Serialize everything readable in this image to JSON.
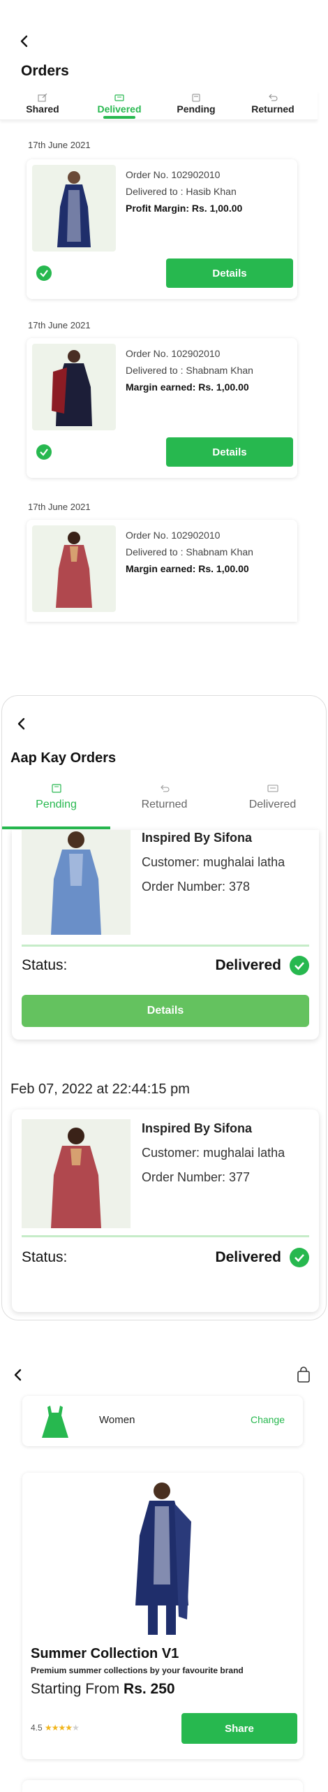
{
  "screen1": {
    "title": "Orders",
    "tabs": [
      {
        "label": "Shared",
        "icon": "share-icon"
      },
      {
        "label": "Delivered",
        "icon": "truck-icon"
      },
      {
        "label": "Pending",
        "icon": "pending-icon"
      },
      {
        "label": "Returned",
        "icon": "return-icon"
      }
    ],
    "active_tab": "Delivered",
    "orders": [
      {
        "date": "17th June 2021",
        "order_no": "Order No. 102902010",
        "delivered_to": "Delivered to : Hasib Khan",
        "margin_label": "Profit Margin:",
        "margin_value": "Rs. 1,00.00",
        "button": "Details"
      },
      {
        "date": "17th June 2021",
        "order_no": "Order No. 102902010",
        "delivered_to": "Delivered to : Shabnam Khan",
        "margin_label": "Margin earned:",
        "margin_value": "Rs. 1,00.00",
        "button": "Details"
      },
      {
        "date": "17th June 2021",
        "order_no": "Order No. 102902010",
        "delivered_to": "Delivered to : Shabnam Khan",
        "margin_label": "Margin earned:",
        "margin_value": "Rs. 1,00.00"
      }
    ]
  },
  "screen2": {
    "title": "Aap Kay Orders",
    "tabs": [
      {
        "label": "Pending",
        "icon": "pending-icon"
      },
      {
        "label": "Returned",
        "icon": "return-icon"
      },
      {
        "label": "Delivered",
        "icon": "truck-icon"
      }
    ],
    "active_tab": "Pending",
    "orders": [
      {
        "brand": "Inspired By Sifona",
        "customer": "Customer: mughalai latha",
        "order_number": "Order Number: 378",
        "status_label": "Status:",
        "status_value": "Delivered",
        "button": "Details"
      },
      {
        "date": "Feb 07, 2022 at 22:44:15 pm",
        "brand": "Inspired By Sifona",
        "customer": "Customer: mughalai latha",
        "order_number": "Order Number: 377",
        "status_label": "Status:",
        "status_value": "Delivered"
      }
    ]
  },
  "screen3": {
    "category": {
      "label": "Women",
      "action": "Change"
    },
    "product": {
      "name": "Summer Collection V1",
      "tagline": "Premium summer collections by your favourite brand",
      "price_prefix": "Starting From",
      "price_value": "Rs. 250",
      "rating": "4.5",
      "button": "Share"
    }
  },
  "colors": {
    "accent": "#27b84f",
    "accent_light": "#64c25f"
  }
}
